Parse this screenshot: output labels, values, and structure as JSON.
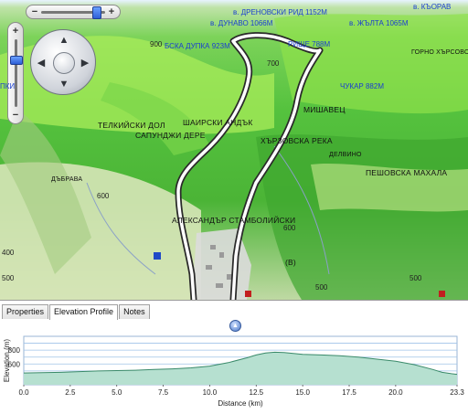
{
  "map": {
    "place_labels": [
      {
        "text": "ТЕЛКИЙСКИ ДОЛ"
      },
      {
        "text": "САПУНДЖИ ДЕРЕ"
      },
      {
        "text": "ШАИРСКИ АНДЪК"
      },
      {
        "text": "ХЪРЗОВСКА РЕКА"
      },
      {
        "text": "МИШАВЕЦ"
      },
      {
        "text": "ПЕШОВСКА МАХАЛА"
      },
      {
        "text": "АЛЕКСАНДЪР СТАМБОЛИЙСКИ"
      },
      {
        "text": "ДЪБРАВА"
      },
      {
        "text": "ДЕЛВИНО"
      },
      {
        "text": "ГОРНО ХЪРСОВО"
      },
      {
        "text": "(В)"
      }
    ],
    "peak_labels": [
      {
        "text": "в. ДРЕНОВСКИ РИД 1152М"
      },
      {
        "text": "в. ДУНАВО 1066М"
      },
      {
        "text": "в. ЖЪЛТА 1065М"
      },
      {
        "text": "в. КЪОРАВ"
      },
      {
        "text": "БСКА ДУПКА 923М"
      },
      {
        "text": "РИЩЕ 788М"
      },
      {
        "text": "ЧУКАР 882М"
      },
      {
        "text": "ПКИ"
      }
    ],
    "contour_labels": [
      {
        "text": "900"
      },
      {
        "text": "700"
      },
      {
        "text": "600"
      },
      {
        "text": "600"
      },
      {
        "text": "500"
      },
      {
        "text": "500"
      },
      {
        "text": "500"
      },
      {
        "text": "400"
      }
    ],
    "controls": {
      "zoom_in": "+",
      "zoom_out": "−",
      "pan_up": "▲",
      "pan_down": "▼",
      "pan_left": "◀",
      "pan_right": "▶"
    },
    "colors": {
      "track": "#ffffff",
      "track_outline": "#2a2a2a",
      "terrain": "#4bb436"
    }
  },
  "panel": {
    "tabs": [
      {
        "label": "Properties",
        "active": false
      },
      {
        "label": "Elevation Profile",
        "active": true
      },
      {
        "label": "Notes",
        "active": false
      }
    ],
    "collapse_icon": "▲"
  },
  "chart_data": {
    "type": "area",
    "xlabel": "Distance  (km)",
    "ylabel": "Elevation  (m)",
    "xlim": [
      0,
      23.3
    ],
    "ylim": [
      300,
      1000
    ],
    "x_ticks": [
      "0.0",
      "2.5",
      "5.0",
      "7.5",
      "10.0",
      "12.5",
      "15.0",
      "17.5",
      "20.0",
      "23.3"
    ],
    "y_ticks": [
      "800",
      "600"
    ],
    "x": [
      0,
      1,
      2,
      3,
      4,
      5,
      6,
      7,
      8,
      9,
      10,
      11,
      12,
      12.5,
      13,
      13.5,
      14,
      15,
      16,
      17,
      17.5,
      18,
      19,
      20,
      21,
      22,
      22.5,
      23,
      23.3
    ],
    "y": [
      470,
      475,
      480,
      490,
      500,
      505,
      510,
      520,
      530,
      545,
      570,
      620,
      690,
      730,
      760,
      770,
      765,
      740,
      730,
      720,
      710,
      700,
      670,
      640,
      590,
      520,
      480,
      460,
      450
    ],
    "colors": {
      "fill": "#b6e0d0",
      "line": "#3a8a6a",
      "grid": "#9fc3e8"
    }
  }
}
